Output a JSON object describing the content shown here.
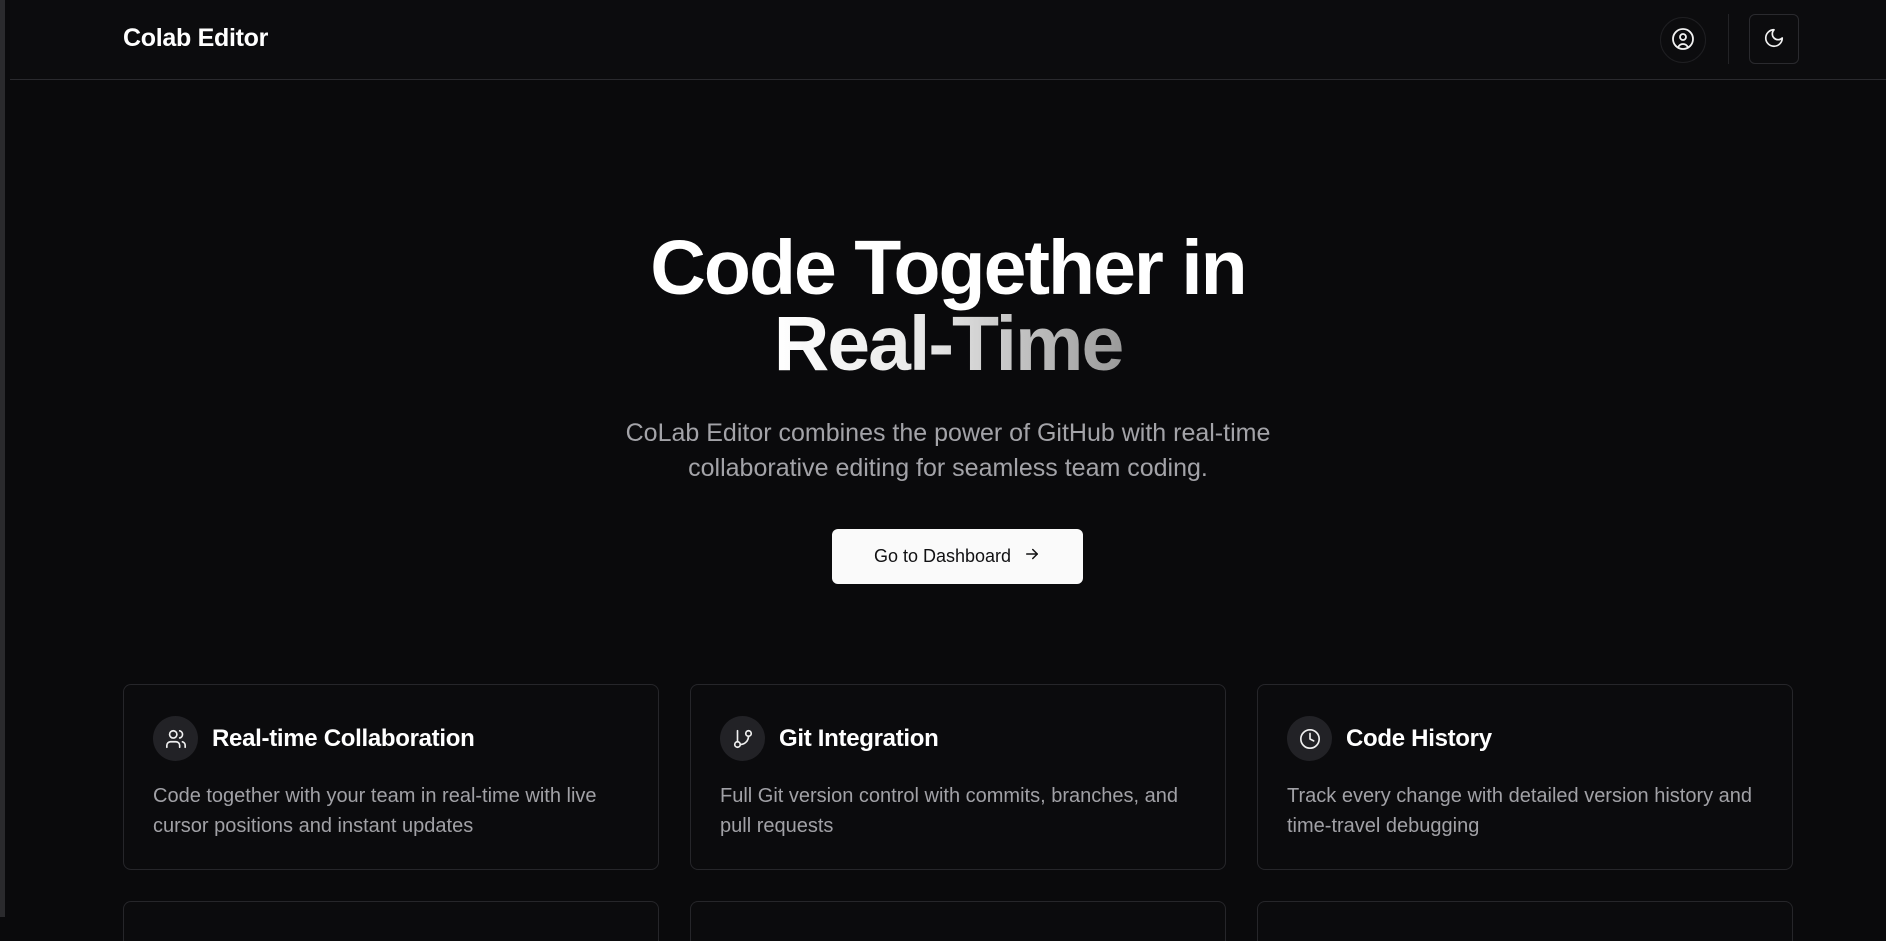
{
  "header": {
    "brand": "Colab Editor",
    "icons": {
      "user": "user-circle-icon",
      "theme": "moon-icon"
    }
  },
  "hero": {
    "title_line1": "Code Together in",
    "title_line2": "Real-Time",
    "subtitle": "CoLab Editor combines the power of GitHub with real-time collaborative editing for seamless team coding.",
    "cta_label": "Go to Dashboard",
    "cta_icon": "arrow-right-icon"
  },
  "features": [
    {
      "title": "Real-time Collaboration",
      "description": "Code together with your team in real-time with live cursor positions and instant updates",
      "icon": "users-icon"
    },
    {
      "title": "Git Integration",
      "description": "Full Git version control with commits, branches, and pull requests",
      "icon": "git-branch-icon"
    },
    {
      "title": "Code History",
      "description": "Track every change with detailed version history and time-travel debugging",
      "icon": "clock-icon"
    }
  ],
  "colors": {
    "background": "#0a0a0c",
    "header_bg": "#0c0c0e",
    "card_border": "#26262a",
    "muted_text": "#a1a1a6",
    "button_bg": "#fafafa"
  }
}
